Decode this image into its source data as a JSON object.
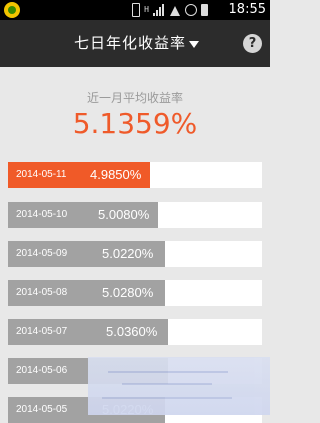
{
  "status_bar": {
    "time": "18:55",
    "icons": [
      "app-icon",
      "phone-icon",
      "network-icon",
      "signal-icon",
      "wifi-icon",
      "alarm-icon",
      "battery-icon"
    ],
    "network_label": "H"
  },
  "header": {
    "title": "七日年化收益率",
    "help_label": "?"
  },
  "summary": {
    "label": "近一月平均收益率",
    "value": "5.1359%"
  },
  "rows": [
    {
      "date": "2014-05-11",
      "value": "4.9850%",
      "active": true,
      "fill": 0.56
    },
    {
      "date": "2014-05-10",
      "value": "5.0080%",
      "active": false,
      "fill": 0.59
    },
    {
      "date": "2014-05-09",
      "value": "5.0220%",
      "active": false,
      "fill": 0.62
    },
    {
      "date": "2014-05-08",
      "value": "5.0280%",
      "active": false,
      "fill": 0.62
    },
    {
      "date": "2014-05-07",
      "value": "5.0360%",
      "active": false,
      "fill": 0.63
    },
    {
      "date": "2014-05-06",
      "value": "",
      "active": false,
      "fill": 0.63
    },
    {
      "date": "2014-05-05",
      "value": "5.0220%",
      "active": false,
      "fill": 0.62
    }
  ],
  "colors": {
    "accent": "#ef5a2a",
    "header_bg": "#2c2c2c",
    "bar_gray": "#a2a2a2",
    "page_bg": "#e8e8e8"
  }
}
